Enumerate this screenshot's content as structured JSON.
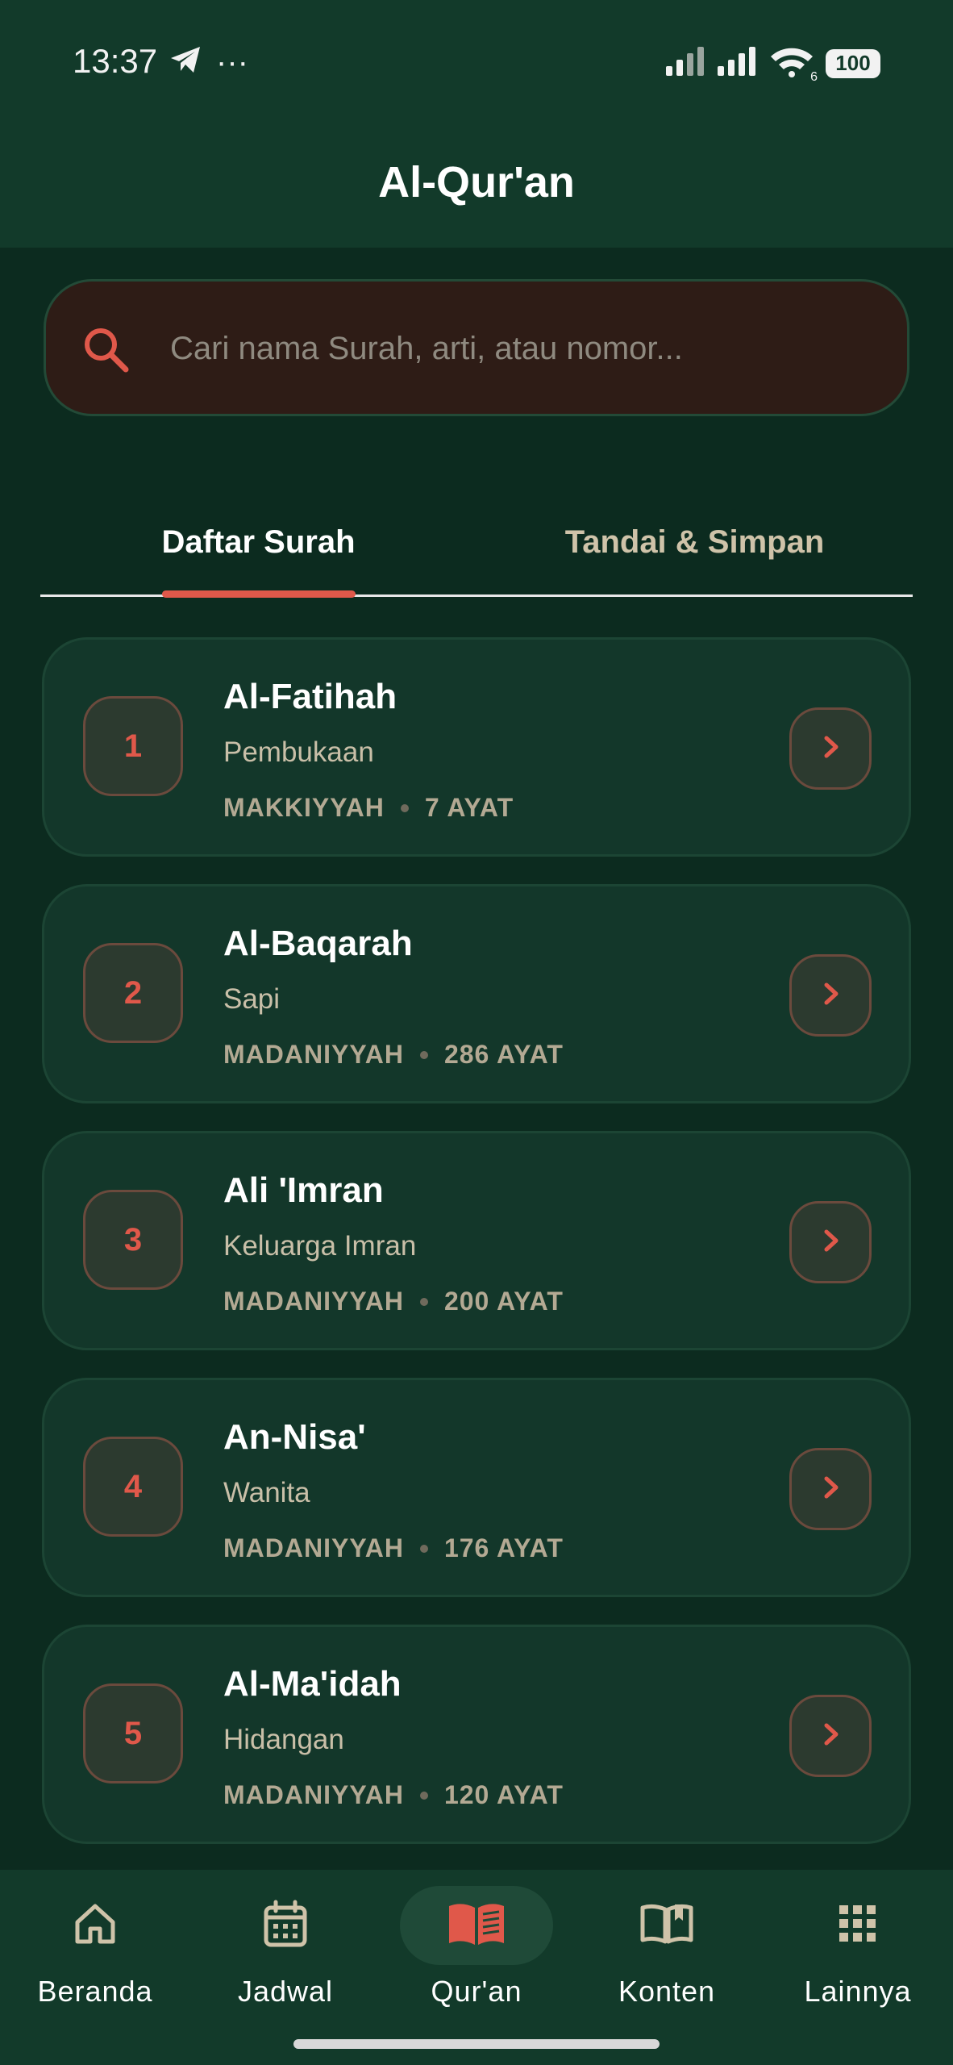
{
  "status_bar": {
    "time": "13:37",
    "overflow": "···",
    "battery": "100",
    "wifi_badge": "6"
  },
  "header": {
    "title": "Al-Qur'an"
  },
  "search": {
    "placeholder": "Cari nama Surah, arti, atau nomor..."
  },
  "tabs": [
    {
      "label": "Daftar Surah",
      "active": true
    },
    {
      "label": "Tandai & Simpan",
      "active": false
    }
  ],
  "surahs": [
    {
      "number": "1",
      "name": "Al-Fatihah",
      "meaning": "Pembukaan",
      "type": "MAKKIYYAH",
      "ayat": "7 AYAT"
    },
    {
      "number": "2",
      "name": "Al-Baqarah",
      "meaning": "Sapi",
      "type": "MADANIYYAH",
      "ayat": "286 AYAT"
    },
    {
      "number": "3",
      "name": "Ali 'Imran",
      "meaning": "Keluarga Imran",
      "type": "MADANIYYAH",
      "ayat": "200 AYAT"
    },
    {
      "number": "4",
      "name": "An-Nisa'",
      "meaning": "Wanita",
      "type": "MADANIYYAH",
      "ayat": "176 AYAT"
    },
    {
      "number": "5",
      "name": "Al-Ma'idah",
      "meaning": "Hidangan",
      "type": "MADANIYYAH",
      "ayat": "120 AYAT"
    }
  ],
  "bottom_nav": [
    {
      "label": "Beranda",
      "icon": "home-icon",
      "active": false
    },
    {
      "label": "Jadwal",
      "icon": "calendar-icon",
      "active": false
    },
    {
      "label": "Qur'an",
      "icon": "book-icon",
      "active": true
    },
    {
      "label": "Konten",
      "icon": "open-book-icon",
      "active": false
    },
    {
      "label": "Lainnya",
      "icon": "grid-icon",
      "active": false
    }
  ],
  "colors": {
    "background": "#0c2b1f",
    "surface": "#123a2a",
    "accent": "#e0584a",
    "muted_text": "#cfc3a9"
  }
}
